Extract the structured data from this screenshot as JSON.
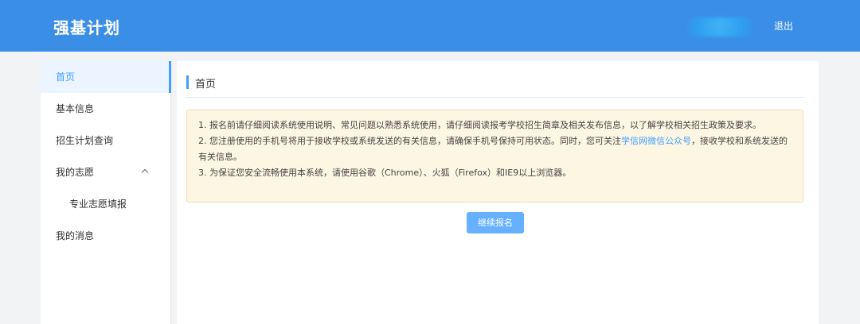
{
  "header": {
    "title": "强基计划",
    "user_blurred": "·······",
    "logout_label": "退出"
  },
  "sidebar": {
    "items": [
      {
        "label": "首页"
      },
      {
        "label": "基本信息"
      },
      {
        "label": "招生计划查询"
      },
      {
        "label": "我的志愿"
      },
      {
        "label": "专业志愿填报"
      },
      {
        "label": "我的消息"
      }
    ]
  },
  "main": {
    "page_title": "首页",
    "notice": {
      "line1": "1. 报名前请仔细阅读系统使用说明、常见问题以熟悉系统使用，请仔细阅读报考学校招生简章及相关发布信息，以了解学校相关招生政策及要求。",
      "line2_before": "2. 您注册使用的手机号将用于接收学校或系统发送的有关信息，请确保手机号保持可用状态。同时，您可关注",
      "line2_link": "学信网微信公众号",
      "line2_after": "，接收学校和系统发送的有关信息。",
      "line3": "3. 为保证您安全流畅使用本系统，请使用谷歌（Chrome）、火狐（Firefox）和IE9以上浏览器。"
    },
    "continue_label": "继续报名"
  },
  "colors": {
    "header_bg": "#3a8ee6",
    "accent": "#409eff",
    "notice_bg": "#fdf6e3",
    "button_bg": "#66b1ff"
  }
}
